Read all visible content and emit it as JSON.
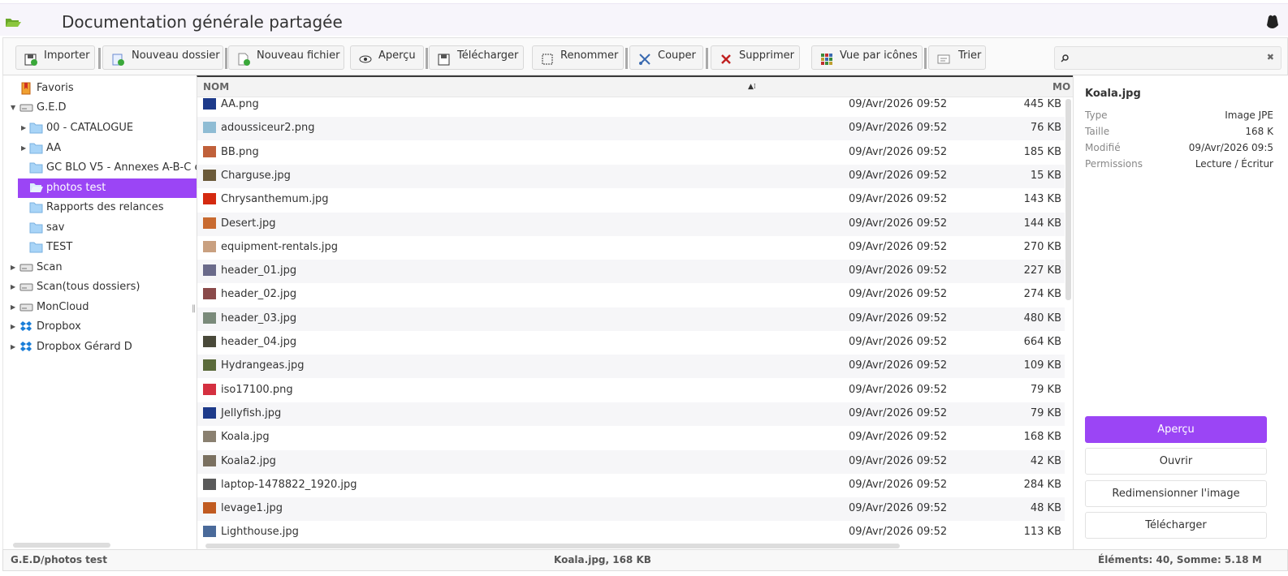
{
  "app": {
    "title": "Documentation générale partagée"
  },
  "toolbar": {
    "buttons": [
      {
        "label": "Importer",
        "icon": "import-icon"
      },
      {
        "label": "Nouveau dossier",
        "icon": "new-folder-icon"
      },
      {
        "label": "Nouveau fichier",
        "icon": "new-file-icon"
      },
      {
        "label": "Aperçu",
        "icon": "eye-icon"
      },
      {
        "label": "Télécharger",
        "icon": "download-icon"
      },
      {
        "label": "Renommer",
        "icon": "rename-icon"
      },
      {
        "label": "Couper",
        "icon": "scissors-icon"
      },
      {
        "label": "Supprimer",
        "icon": "delete-icon"
      },
      {
        "label": "Vue par icônes",
        "icon": "grid-view-icon"
      },
      {
        "label": "Trier",
        "icon": "sort-icon"
      }
    ],
    "search": {
      "placeholder": "",
      "value": ""
    }
  },
  "tree": {
    "items": [
      {
        "label": "Favoris",
        "type": "favorites"
      },
      {
        "label": "G.E.D",
        "type": "drive",
        "expanded": true
      },
      {
        "label": "00 - CATALOGUE",
        "type": "folder"
      },
      {
        "label": "AA",
        "type": "folder"
      },
      {
        "label": "GC BLO V5 - Annexes A-B-C e",
        "type": "folder"
      },
      {
        "label": "photos test",
        "type": "folder",
        "selected": true
      },
      {
        "label": "Rapports des relances",
        "type": "folder"
      },
      {
        "label": "sav",
        "type": "folder"
      },
      {
        "label": "TEST",
        "type": "folder"
      },
      {
        "label": "Scan",
        "type": "drive"
      },
      {
        "label": "Scan(tous dossiers)",
        "type": "drive"
      },
      {
        "label": "MonCloud",
        "type": "drive"
      },
      {
        "label": "Dropbox",
        "type": "dropbox"
      },
      {
        "label": "Dropbox Gérard D",
        "type": "dropbox"
      }
    ]
  },
  "list": {
    "columns": {
      "name": "NOM",
      "modified": "MO"
    },
    "files": [
      {
        "name": "AA.png",
        "date": "09/Avr/2026 09:52",
        "size": "445 KB",
        "thumb": "#1d3a8a"
      },
      {
        "name": "adoussiceur2.png",
        "date": "09/Avr/2026 09:52",
        "size": "76 KB",
        "thumb": "#8fbcd4"
      },
      {
        "name": "BB.png",
        "date": "09/Avr/2026 09:52",
        "size": "185 KB",
        "thumb": "#c0603a"
      },
      {
        "name": "Charguse.jpg",
        "date": "09/Avr/2026 09:52",
        "size": "15 KB",
        "thumb": "#6b5a3a"
      },
      {
        "name": "Chrysanthemum.jpg",
        "date": "09/Avr/2026 09:52",
        "size": "143 KB",
        "thumb": "#d42a10"
      },
      {
        "name": "Desert.jpg",
        "date": "09/Avr/2026 09:52",
        "size": "144 KB",
        "thumb": "#c86a30"
      },
      {
        "name": "equipment-rentals.jpg",
        "date": "09/Avr/2026 09:52",
        "size": "270 KB",
        "thumb": "#c9a080"
      },
      {
        "name": "header_01.jpg",
        "date": "09/Avr/2026 09:52",
        "size": "227 KB",
        "thumb": "#6a6a8a"
      },
      {
        "name": "header_02.jpg",
        "date": "09/Avr/2026 09:52",
        "size": "274 KB",
        "thumb": "#8a4a4a"
      },
      {
        "name": "header_03.jpg",
        "date": "09/Avr/2026 09:52",
        "size": "480 KB",
        "thumb": "#7a8a7a"
      },
      {
        "name": "header_04.jpg",
        "date": "09/Avr/2026 09:52",
        "size": "664 KB",
        "thumb": "#4a4a3a"
      },
      {
        "name": "Hydrangeas.jpg",
        "date": "09/Avr/2026 09:52",
        "size": "109 KB",
        "thumb": "#5a6a3a"
      },
      {
        "name": "iso17100.png",
        "date": "09/Avr/2026 09:52",
        "size": "79 KB",
        "thumb": "#d43040"
      },
      {
        "name": "Jellyfish.jpg",
        "date": "09/Avr/2026 09:52",
        "size": "79 KB",
        "thumb": "#1d3a8a"
      },
      {
        "name": "Koala.jpg",
        "date": "09/Avr/2026 09:52",
        "size": "168 KB",
        "thumb": "#8a8070"
      },
      {
        "name": "Koala2.jpg",
        "date": "09/Avr/2026 09:52",
        "size": "42 KB",
        "thumb": "#7a7060"
      },
      {
        "name": "laptop-1478822_1920.jpg",
        "date": "09/Avr/2026 09:52",
        "size": "284 KB",
        "thumb": "#5a5a5a"
      },
      {
        "name": "levage1.jpg",
        "date": "09/Avr/2026 09:52",
        "size": "48 KB",
        "thumb": "#c05a20"
      },
      {
        "name": "Lighthouse.jpg",
        "date": "09/Avr/2026 09:52",
        "size": "113 KB",
        "thumb": "#4a6a9a"
      }
    ]
  },
  "details": {
    "title": "Koala.jpg",
    "rows": [
      {
        "key": "Type",
        "value": "Image JPE"
      },
      {
        "key": "Taille",
        "value": "168 K"
      },
      {
        "key": "Modifié",
        "value": "09/Avr/2026 09:5"
      },
      {
        "key": "Permissions",
        "value": "Lecture / Écritur"
      }
    ],
    "buttons": [
      "Aperçu",
      "Ouvrir",
      "Redimensionner l'image",
      "Télécharger"
    ]
  },
  "status": {
    "path": "G.E.D/photos test",
    "selection": "Koala.jpg, 168 KB",
    "summary": "Éléments: 40, Somme: 5.18 M"
  },
  "colors": {
    "accent": "#9b45f5",
    "folder": "#a8d4f7",
    "title_folder": "#8cc63f"
  }
}
